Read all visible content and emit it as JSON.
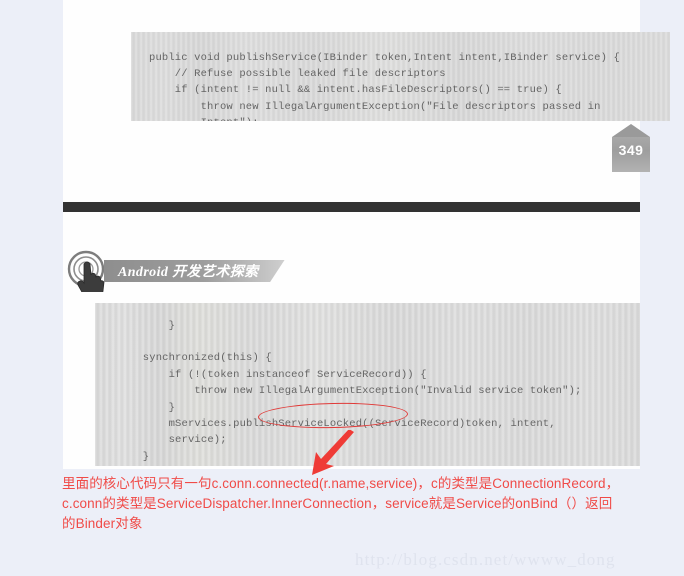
{
  "background_color": "#eceff8",
  "page_color": "#fefefe",
  "annotation_color": "#f04b48",
  "watermark_color": "#dfe3ee",
  "divider_color": "#323232",
  "top_scan": {
    "code_block": {
      "language": "java",
      "lines": [
        "public void publishService(IBinder token,Intent intent,IBinder service) {",
        "    // Refuse possible leaked file descriptors",
        "    if (intent != null && intent.hasFileDescriptors() == true) {",
        "        throw new IllegalArgumentException(\"File descriptors passed in",
        "        Intent\");"
      ],
      "text": "public void publishService(IBinder token,Intent intent,IBinder service) {\n    // Refuse possible leaked file descriptors\n    if (intent != null && intent.hasFileDescriptors() == true) {\n        throw new IllegalArgumentException(\"File descriptors passed in\n        Intent\");"
    },
    "page_number": "349"
  },
  "bottom_scan": {
    "book_header": {
      "icon": "touch-hand-icon",
      "title": "Android 开发艺术探索"
    },
    "code_block": {
      "language": "java",
      "lines": [
        "        }",
        "",
        "    synchronized(this) {",
        "        if (!(token instanceof ServiceRecord)) {",
        "            throw new IllegalArgumentException(\"Invalid service token\");",
        "        }",
        "        mServices.publishServiceLocked((ServiceRecord)token, intent,",
        "        service);",
        "    }",
        "}"
      ],
      "text": "        }\n\n    synchronized(this) {\n        if (!(token instanceof ServiceRecord)) {\n            throw new IllegalArgumentException(\"Invalid service token\");\n        }\n        mServices.publishServiceLocked((ServiceRecord)token, intent,\n        service);\n    }\n}"
    },
    "highlight": {
      "shape": "ellipse",
      "target_text": "publishServiceLocked(",
      "color": "#e03a38"
    },
    "arrow": {
      "shape": "arrow",
      "direction": "down-left",
      "color": "#ef3b36"
    }
  },
  "annotation": {
    "lines": [
      "里面的核心代码只有一句c.conn.connected(r.name,service)，c的类型是ConnectionRecord，",
      "c.conn的类型是ServiceDispatcher.InnerConnection，service就是Service的onBind（）返回",
      "的Binder对象"
    ]
  },
  "watermark": {
    "text": "http://blog.csdn.net/wwww_dong"
  }
}
